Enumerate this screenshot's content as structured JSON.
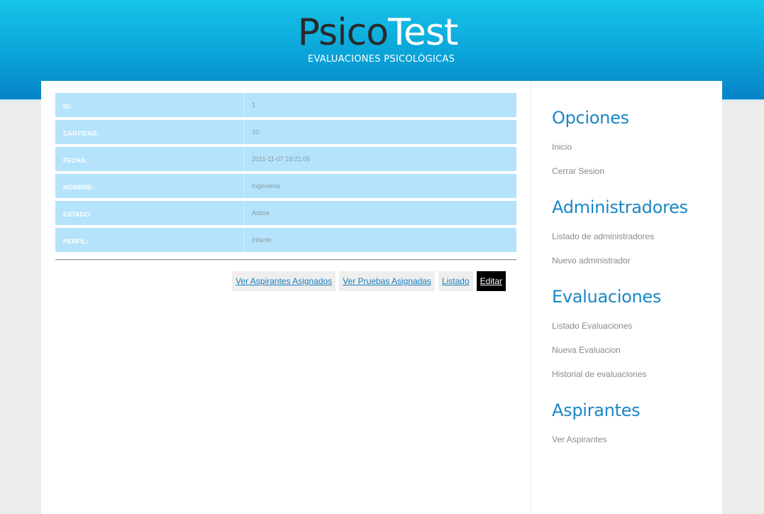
{
  "header": {
    "logo_part1": "Psico",
    "logo_part2": "Test",
    "subtitle": "EVALUACIONES PSICOLÓGICAS"
  },
  "details": [
    {
      "label": "ID:",
      "value": "1"
    },
    {
      "label": "CANTIDAD:",
      "value": "10"
    },
    {
      "label": "FECHA:",
      "value": "2011-11-07 19:21:05"
    },
    {
      "label": "NOMBRE:",
      "value": "Ingenieria"
    },
    {
      "label": "ESTADO:",
      "value": "Activa"
    },
    {
      "label": "PERFIL:",
      "value": "Infante"
    }
  ],
  "actions": {
    "ver_aspirantes": "Ver Aspirantes Asignados",
    "ver_pruebas": "Ver Pruebas Asignadas",
    "listado": "Listado",
    "editar": "Editar"
  },
  "sidebar": {
    "opciones": {
      "title": "Opciones",
      "links": [
        "Inicio",
        "Cerrar Sesion"
      ]
    },
    "administradores": {
      "title": "Administradores",
      "links": [
        "Listado de administradores",
        "Nuevo administrador"
      ]
    },
    "evaluaciones": {
      "title": "Evaluaciones",
      "links": [
        "Listado Evaluaciones",
        "Nueva Evaluacion",
        "Historial de evaluaciones"
      ]
    },
    "aspirantes": {
      "title": "Aspirantes",
      "links": [
        "Ver Aspirantes"
      ]
    }
  },
  "colors": {
    "header_top": "#16c4e8",
    "header_bottom": "#0683c6",
    "row_bg": "#b4e3fb",
    "sidebar_title": "#1a87c5",
    "link_blue": "#1a7fc0"
  }
}
